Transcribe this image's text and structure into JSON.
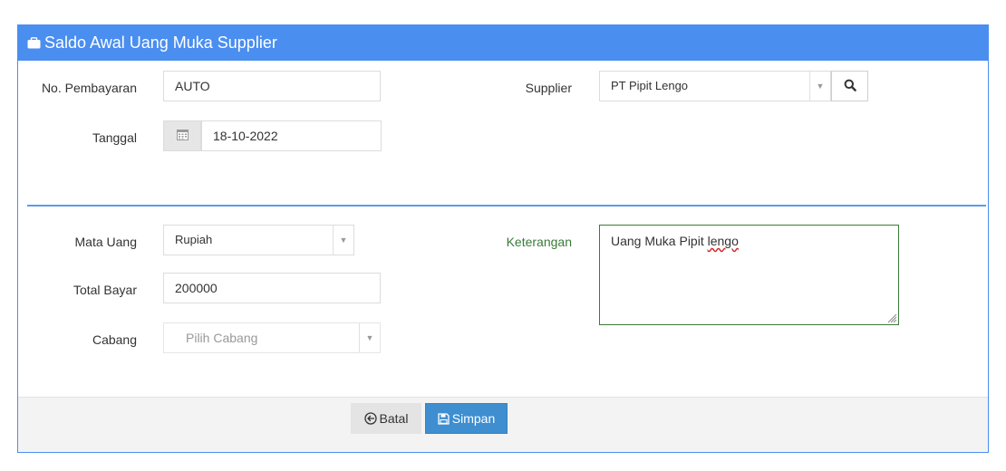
{
  "panel": {
    "title": "Saldo Awal Uang Muka Supplier",
    "title_icon": "briefcase-icon",
    "header_color": "#4a8ef0"
  },
  "form": {
    "no_pembayaran": {
      "label": "No. Pembayaran",
      "value": "AUTO"
    },
    "tanggal": {
      "label": "Tanggal",
      "value": "18-10-2022",
      "icon": "calendar-icon"
    },
    "supplier": {
      "label": "Supplier",
      "value": "PT Pipit Lengo",
      "search_icon": "search-icon"
    },
    "mata_uang": {
      "label": "Mata Uang",
      "value": "Rupiah"
    },
    "total_bayar": {
      "label": "Total Bayar",
      "value": "200000"
    },
    "cabang": {
      "label": "Cabang",
      "placeholder": "Pilih Cabang"
    },
    "keterangan": {
      "label": "Keterangan",
      "value_start": "Uang Muka Pipit ",
      "value_misspelled": "lengo"
    }
  },
  "footer": {
    "batal_label": "Batal",
    "batal_icon": "circle-arrow-left-icon",
    "simpan_label": "Simpan",
    "simpan_icon": "floppy-disk-icon"
  }
}
